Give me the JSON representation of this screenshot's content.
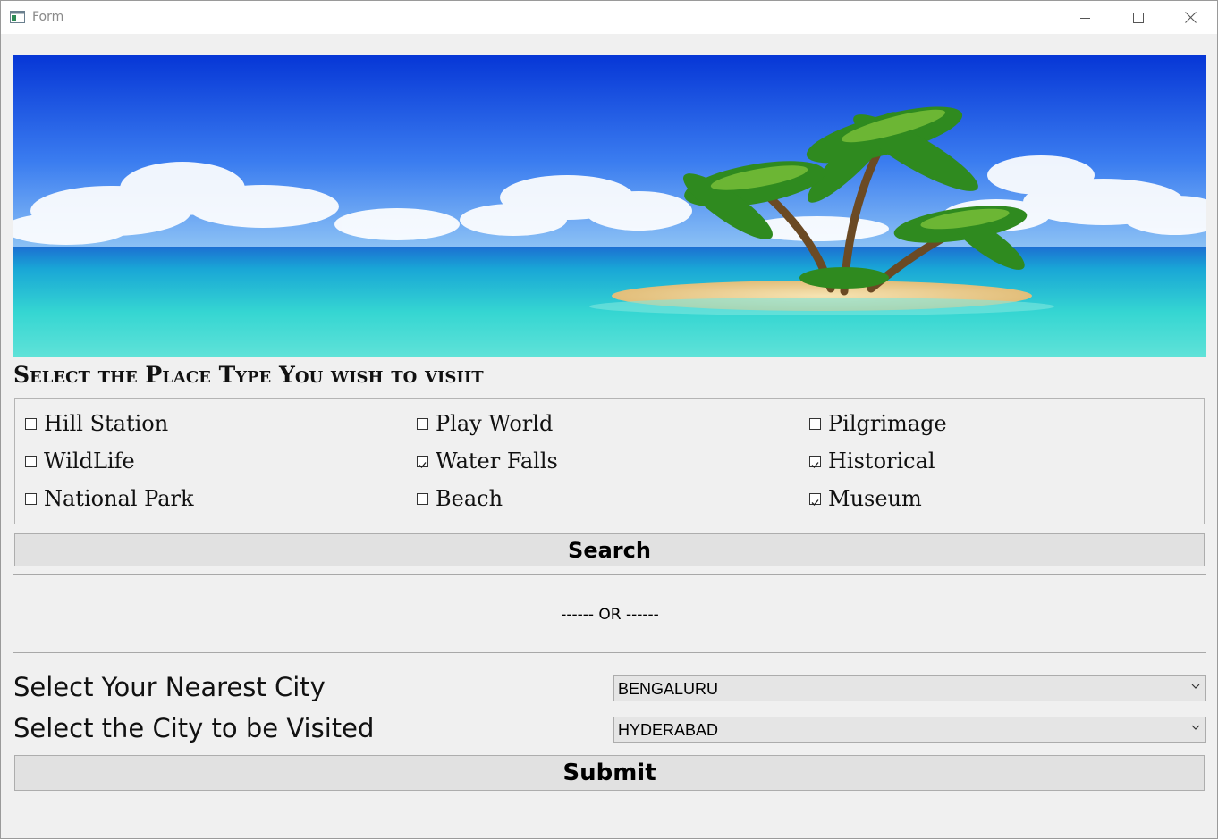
{
  "window": {
    "title": "Form",
    "icon": "app-window-icon",
    "controls": [
      "minimize-icon",
      "maximize-icon",
      "close-icon"
    ]
  },
  "banner": {
    "description_icon": "tropical-island-banner-image"
  },
  "heading": "Select the Place Type You wish to visiit",
  "place_types": [
    {
      "label": "Hill Station",
      "checked": false
    },
    {
      "label": "Play World",
      "checked": false
    },
    {
      "label": "Pilgrimage",
      "checked": false
    },
    {
      "label": "WildLife",
      "checked": false
    },
    {
      "label": "Water Falls",
      "checked": true
    },
    {
      "label": "Historical",
      "checked": true
    },
    {
      "label": "National Park",
      "checked": false
    },
    {
      "label": "Beach",
      "checked": false
    },
    {
      "label": "Museum",
      "checked": true
    }
  ],
  "search_button": "Search",
  "or_separator": "------ OR ------",
  "nearest_city": {
    "label": "Select Your Nearest City",
    "value": "BENGALURU"
  },
  "visit_city": {
    "label": "Select the City to be Visited",
    "value": "HYDERABAD"
  },
  "submit_button": "Submit",
  "colors": {
    "background": "#f0f0f0",
    "button": "#e1e1e1",
    "sky": "#0a3fd8",
    "sea": "#2fd0d0",
    "sand": "#f2d9a0"
  }
}
